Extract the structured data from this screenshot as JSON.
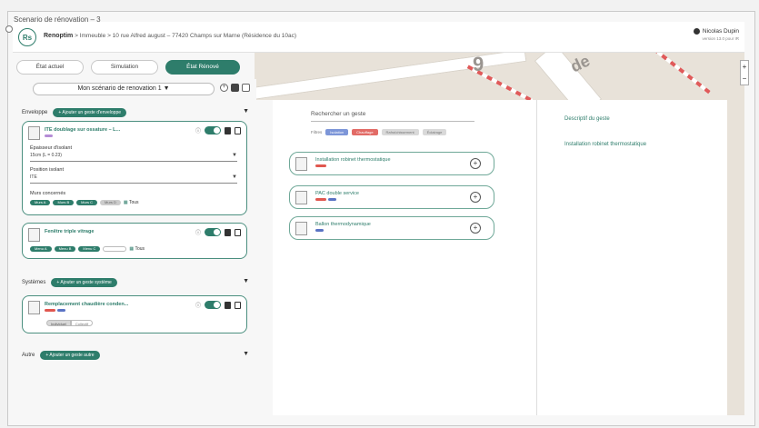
{
  "window": {
    "title": "Scenario de rénovation – 3"
  },
  "header": {
    "logo": "Rs",
    "app_name": "Renoptim",
    "crumb_separator": ">",
    "crumb_building": "Immeuble",
    "crumb_address": "10 rue Alfred august – 77420 Champs sur Marne",
    "crumb_note": "(Résidence du 10ac)",
    "user_name": "Nicolas Dupin",
    "user_sub": "version 13.0 pour IR"
  },
  "tabs": [
    {
      "label": "État actuel"
    },
    {
      "label": "Simulation"
    },
    {
      "label": "État Rénové"
    }
  ],
  "scenario": {
    "label": "Mon scénario de renovation 1",
    "arrow": "▼"
  },
  "sections": {
    "envelope": {
      "label": "Enveloppe",
      "add": "+ Ajouter un geste d'enveloppe"
    },
    "systems": {
      "label": "Systèmes",
      "add": "+ Ajouter un geste système"
    },
    "other": {
      "label": "Autre",
      "add": "+ Ajouter un geste autre"
    }
  },
  "cards": {
    "ite": {
      "title": "ITE doublage sur ossature – L...",
      "thickness_label": "Épaisseur d'isolant",
      "thickness_value": "15cm (L = 0.23)",
      "position_label": "Position isolant",
      "position_value": "ITE",
      "walls_label": "Murs concernés",
      "walls_chips": [
        "Murs A",
        "Murs B",
        "Murs C",
        "Murs D"
      ],
      "all_label": "Tous"
    },
    "window": {
      "title": "Fenêtre triple vitrage",
      "chips": [
        "Menu A",
        "Menu B",
        "Menu C",
        "Menu D"
      ],
      "all_label": "Tous"
    },
    "boiler": {
      "title": "Remplacement chaudière conden...",
      "seg_on": "Individuel",
      "seg_off": "Collectif"
    }
  },
  "center": {
    "search_placeholder": "Rechercher un geste",
    "filters_label": "Filtres",
    "filters": [
      "Isolation",
      "Chauffage",
      "Rafraîchissement",
      "Éclairage"
    ],
    "gestures": [
      {
        "title": "Installation robinet thermostatique",
        "add": "+"
      },
      {
        "title": "PAC double service",
        "add": "+"
      },
      {
        "title": "Ballon thermodynamique",
        "add": "+"
      }
    ]
  },
  "right_panel": {
    "title": "Descriptif du geste",
    "subtitle": "Installation robinet thermostatique"
  },
  "map": {
    "labels": [
      "9",
      "de"
    ]
  },
  "zoom": {
    "plus": "+",
    "minus": "−"
  }
}
